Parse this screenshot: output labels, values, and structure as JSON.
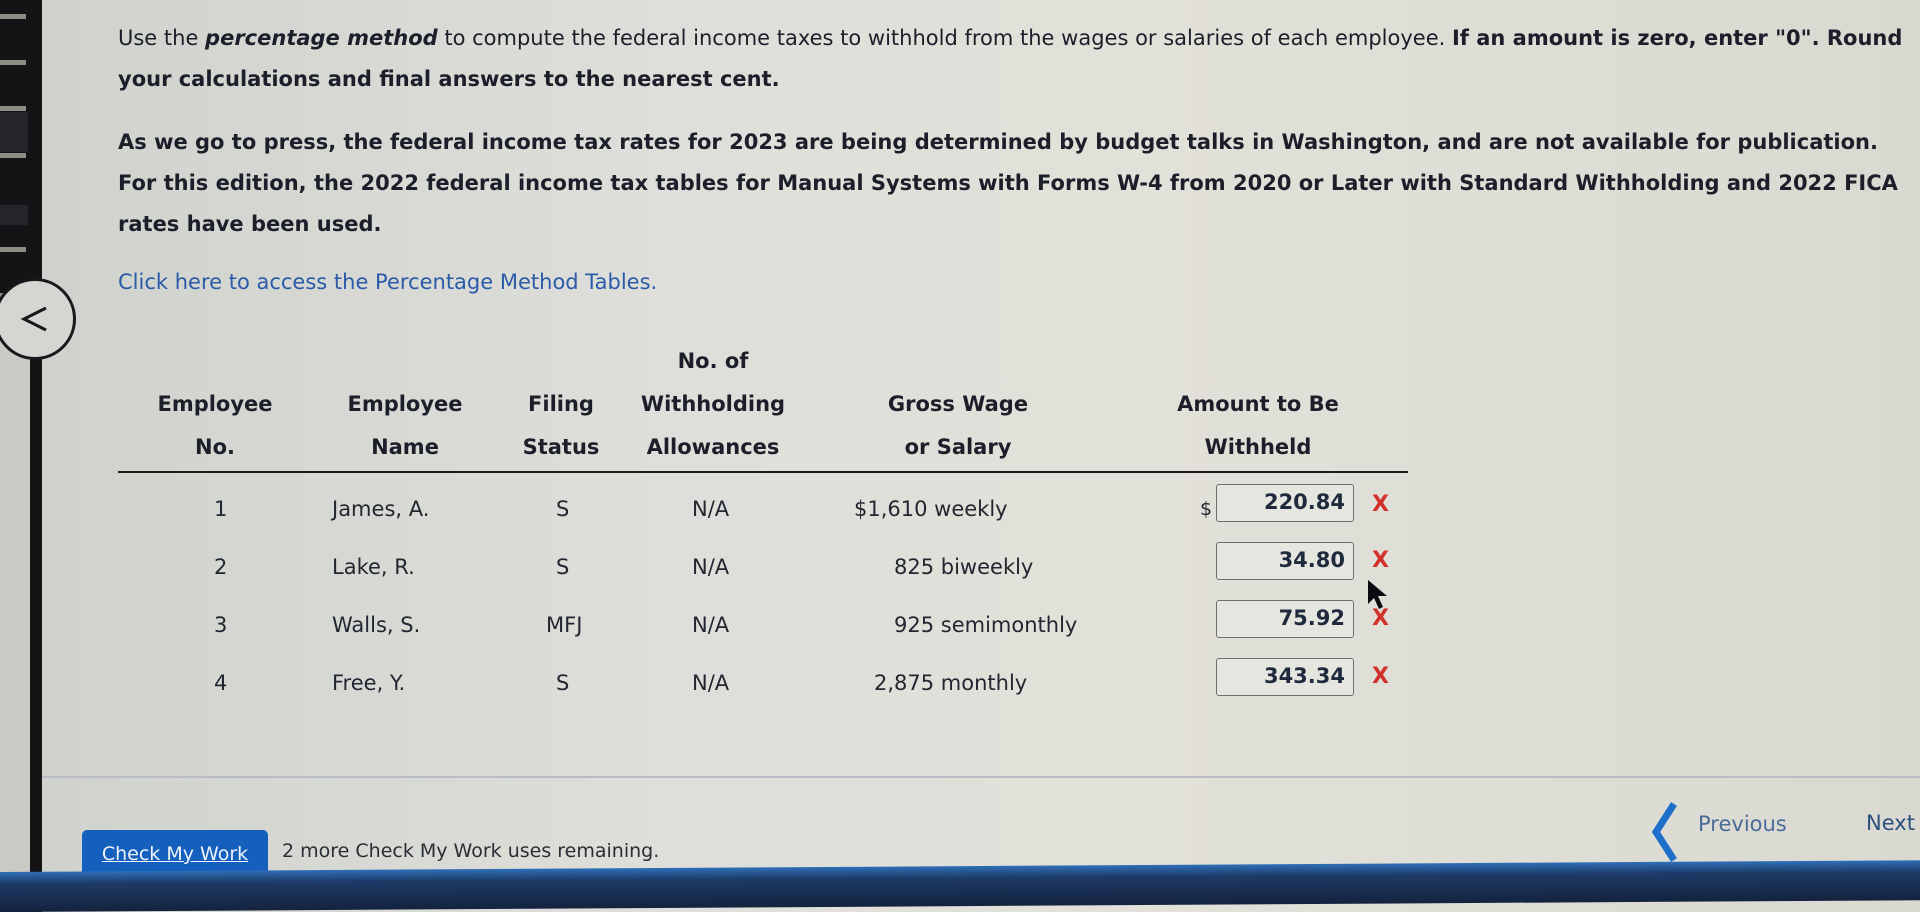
{
  "instructions": {
    "line1_pre": "Use the ",
    "line1_emph": "percentage method",
    "line1_mid": " to compute the federal income taxes to withhold from the wages or salaries of each employee. ",
    "line1_bold": "If an amount is zero, enter \"0\". Round your calculations and final answers to the nearest cent.",
    "note": "As we go to press, the federal income tax rates for 2023 are being determined by budget talks in Washington, and are not available for publication. For this edition, the 2022 federal income tax tables for Manual Systems with Forms W-4 from 2020 or Later with Standard Withholding and 2022 FICA rates have been used.",
    "link_text": "Click here to access the Percentage Method Tables."
  },
  "table": {
    "headers": {
      "employee_no": [
        "Employee",
        "No."
      ],
      "employee_name": [
        "Employee",
        "Name"
      ],
      "filing_status": [
        "Filing",
        "Status"
      ],
      "allowances": [
        "No. of",
        "Withholding",
        "Allowances"
      ],
      "gross_wage": [
        "Gross Wage",
        "or Salary"
      ],
      "amount_withheld": [
        "Amount to Be",
        "Withheld"
      ]
    },
    "currency_symbol": "$",
    "rows": [
      {
        "no": "1",
        "name": "James, A.",
        "status": "S",
        "allowances": "N/A",
        "gross": "$1,610 weekly",
        "amount": "220.84",
        "result": "X",
        "show_dollar": true
      },
      {
        "no": "2",
        "name": "Lake, R.",
        "status": "S",
        "allowances": "N/A",
        "gross": "825 biweekly",
        "amount": "34.80",
        "result": "X",
        "show_dollar": false
      },
      {
        "no": "3",
        "name": "Walls, S.",
        "status": "MFJ",
        "allowances": "N/A",
        "gross": "925 semimonthly",
        "amount": "75.92",
        "result": "X",
        "show_dollar": false
      },
      {
        "no": "4",
        "name": "Free, Y.",
        "status": "S",
        "allowances": "N/A",
        "gross": "2,875 monthly",
        "amount": "343.34",
        "result": "X",
        "show_dollar": false
      }
    ]
  },
  "footer": {
    "check_button": "Check My Work",
    "remaining_text": "2 more Check My Work uses remaining.",
    "previous_label": "Previous",
    "next_label": "Next"
  },
  "colors": {
    "accent": "#1560bd",
    "link": "#2a5aa8",
    "incorrect": "#d2302a"
  }
}
